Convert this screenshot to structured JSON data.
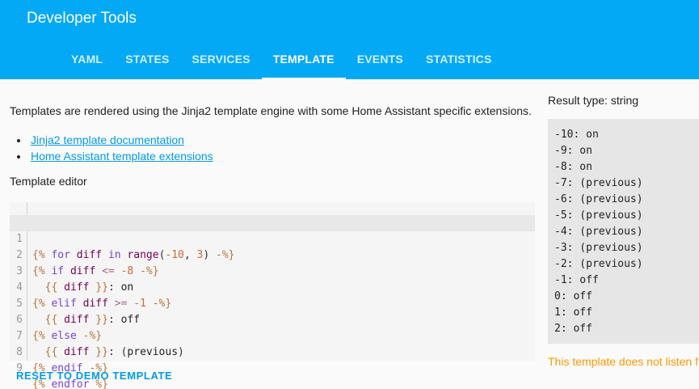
{
  "header": {
    "title": "Developer Tools",
    "tabs": [
      "YAML",
      "STATES",
      "SERVICES",
      "TEMPLATE",
      "EVENTS",
      "STATISTICS"
    ],
    "active_tab": "TEMPLATE"
  },
  "main": {
    "intro": "Templates are rendered using the Jinja2 template engine with some Home Assistant specific extensions.",
    "links": [
      "Jinja2 template documentation",
      "Home Assistant template extensions"
    ],
    "editor_label": "Template editor",
    "reset_label": "RESET TO DEMO TEMPLATE"
  },
  "editor": {
    "line_numbers": [
      "1",
      "2",
      "3",
      "4",
      "5",
      "6",
      "7",
      "8",
      "9"
    ],
    "lines": [
      "{% for diff in range(-10, 3) -%}",
      "{% if diff <= -8 -%}",
      "  {{ diff }}: on",
      "{% elif diff >= -1 -%}",
      "  {{ diff }}: off",
      "{% else -%}",
      "  {{ diff }}: (previous)",
      "{% endif -%}",
      "{% endfor %}"
    ]
  },
  "result": {
    "type_label": "Result type: string",
    "lines": [
      "-10: on",
      "-9: on",
      "-8: on",
      "-7: (previous)",
      "-6: (previous)",
      "-5: (previous)",
      "-4: (previous)",
      "-3: (previous)",
      "-2: (previous)",
      "-1: off",
      "0: off",
      "1: off",
      "2: off"
    ],
    "listen_note": "This template does not listen f"
  },
  "colors": {
    "header": "#03a9f4",
    "link": "#039be5",
    "warning": "#ff9800"
  }
}
